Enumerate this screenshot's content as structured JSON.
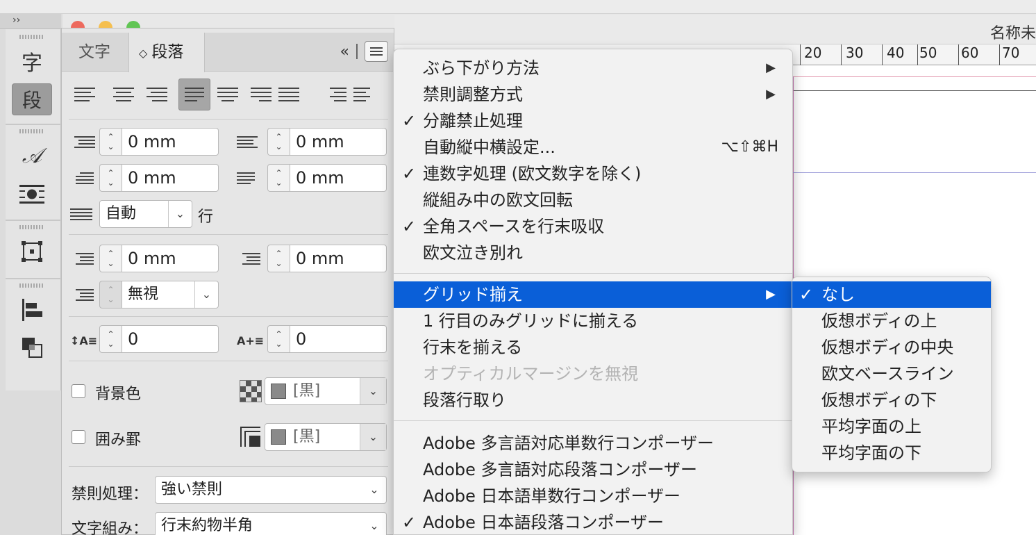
{
  "toolstrip": {
    "expand_glyph": "››"
  },
  "panel": {
    "tabs": [
      {
        "label": "文字"
      },
      {
        "label": "段落",
        "prefix": "◇"
      }
    ],
    "collapse_glyph": "«",
    "left_indent": {
      "value": "0 mm"
    },
    "right_indent": {
      "value": "0 mm"
    },
    "first_line_indent": {
      "value": "0 mm"
    },
    "last_line_right_indent": {
      "value": "0 mm"
    },
    "line_spacing": {
      "value": "自動",
      "unit": "行"
    },
    "space_before": {
      "value": "0 mm"
    },
    "space_after": {
      "value": "0 mm"
    },
    "char_align": {
      "value": "無視"
    },
    "drop_cap_lines": {
      "value": "0"
    },
    "drop_cap_chars": {
      "value": "0"
    },
    "background_color": {
      "label": "背景色",
      "color_name": "[黒]",
      "checked": false
    },
    "border": {
      "label": "囲み罫",
      "color_name": "[黒]",
      "checked": false
    },
    "kinsoku": {
      "label": "禁則処理：",
      "value": "強い禁則"
    },
    "mojikumi": {
      "label": "文字組み：",
      "value": "行末約物半角"
    }
  },
  "document": {
    "title": "名称未",
    "ruler_labels": [
      "20",
      "30",
      "40",
      "50",
      "60",
      "70"
    ]
  },
  "context_menu": {
    "items": [
      {
        "label": "ぶら下がり方法",
        "check": "",
        "submenu": true
      },
      {
        "label": "禁則調整方式",
        "check": "",
        "submenu": true
      },
      {
        "label": "分離禁止処理",
        "check": "✓"
      },
      {
        "label": "自動縦中横設定...",
        "check": "",
        "shortcut": "⌥⇧⌘H"
      },
      {
        "label": "連数字処理 (欧文数字を除く)",
        "check": "✓"
      },
      {
        "label": "縦組み中の欧文回転",
        "check": ""
      },
      {
        "label": "全角スペースを行末吸収",
        "check": "✓"
      },
      {
        "label": "欧文泣き別れ",
        "check": ""
      },
      {
        "label": "グリッド揃え",
        "check": "",
        "submenu": true,
        "highlighted": true
      },
      {
        "label": "1 行目のみグリッドに揃える",
        "check": ""
      },
      {
        "label": "行末を揃える",
        "check": ""
      },
      {
        "label": "オプティカルマージンを無視",
        "check": "",
        "disabled": true
      },
      {
        "label": "段落行取り",
        "check": ""
      },
      {
        "label": "Adobe 多言語対応単数行コンポーザー",
        "check": ""
      },
      {
        "label": "Adobe 多言語対応段落コンポーザー",
        "check": ""
      },
      {
        "label": "Adobe 日本語単数行コンポーザー",
        "check": ""
      },
      {
        "label": "Adobe 日本語段落コンポーザー",
        "check": "✓"
      }
    ],
    "submenu_arrow": "▶"
  },
  "grid_submenu": {
    "items": [
      {
        "label": "なし",
        "check": "✓",
        "highlighted": true
      },
      {
        "label": "仮想ボディの上",
        "check": ""
      },
      {
        "label": "仮想ボディの中央",
        "check": ""
      },
      {
        "label": "欧文ベースライン",
        "check": ""
      },
      {
        "label": "仮想ボディの下",
        "check": ""
      },
      {
        "label": "平均字面の上",
        "check": ""
      },
      {
        "label": "平均字面の下",
        "check": ""
      }
    ]
  }
}
